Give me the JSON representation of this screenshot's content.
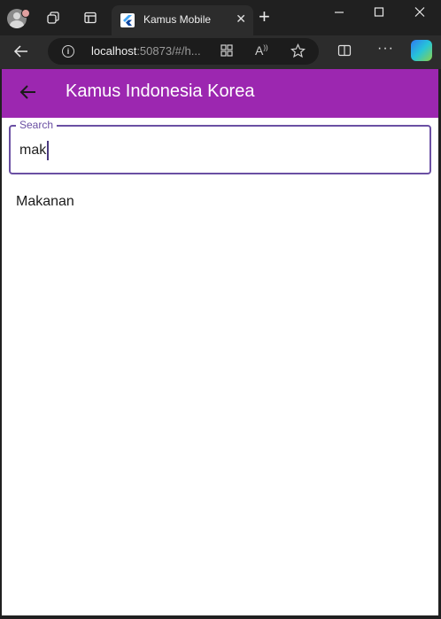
{
  "browser": {
    "tab_title": "Kamus Mobile",
    "url_host": "localhost",
    "url_rest": ":50873/#/h...",
    "icons": [
      "profile-icon",
      "workspaces-icon",
      "tab-actions-icon",
      "close-icon",
      "plus-icon",
      "minimize-icon",
      "maximize-icon",
      "close-window-icon",
      "back-arrow-icon",
      "site-info-icon",
      "apps-icon",
      "read-aloud-icon",
      "favorite-star-icon",
      "split-screen-icon",
      "more-icon",
      "copilot-icon"
    ]
  },
  "appbar": {
    "title": "Kamus Indonesia Korea",
    "color": "#9c27b0"
  },
  "search": {
    "label": "Search",
    "value": "mak",
    "border_color": "#6a4fa3"
  },
  "results": [
    {
      "label": "Makanan"
    }
  ]
}
